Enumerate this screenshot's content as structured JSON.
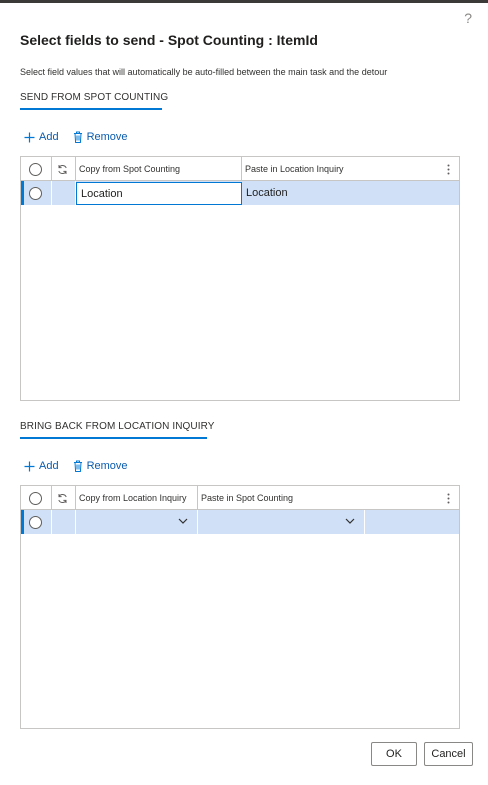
{
  "dialog": {
    "title": "Select fields to send - Spot Counting : ItemId",
    "help_glyph": "?",
    "description": "Select field values that will automatically be auto-filled between the main task and the detour"
  },
  "send_section": {
    "header": "SEND FROM SPOT COUNTING",
    "add_label": "Add",
    "remove_label": "Remove",
    "columns": [
      "Copy from Spot Counting",
      "Paste in Location Inquiry"
    ],
    "rows": [
      {
        "copy_from": "Location",
        "paste_in": "Location"
      }
    ]
  },
  "bring_section": {
    "header": "BRING BACK FROM LOCATION INQUIRY",
    "add_label": "Add",
    "remove_label": "Remove",
    "columns": [
      "Copy from Location Inquiry",
      "Paste in Spot Counting"
    ],
    "rows": [
      {
        "copy_from": "",
        "paste_in": ""
      }
    ]
  },
  "footer": {
    "ok_label": "OK",
    "cancel_label": "Cancel"
  },
  "colors": {
    "accent": "#0078d4",
    "selected_row": "#cfe0f7",
    "link": "#0b5cad"
  },
  "icons": [
    "help-icon",
    "add-icon",
    "delete-icon",
    "refresh-icon",
    "more-options-icon",
    "chevron-down-icon",
    "radio-icon"
  ]
}
